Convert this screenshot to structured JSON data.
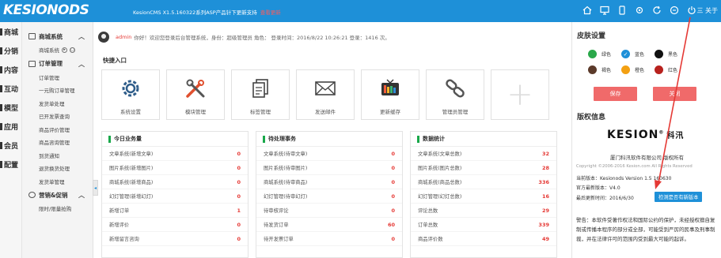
{
  "header": {
    "logo": "KESIONODS",
    "version_text": "KesionCMS X1.5.160322系列ASP产品针下更新支持",
    "version_link": "查看更新",
    "menu_label": "三 关于"
  },
  "leftnav": [
    "商城",
    "分销",
    "内容",
    "互动",
    "模型",
    "应用",
    "会员",
    "配置"
  ],
  "sidebar": {
    "group1": "商城系统",
    "group1_sub": "商城系统",
    "group2": "订单管理",
    "orders": [
      "订单管理",
      "一元购订单管理",
      "发货单处理",
      "已开发票查询",
      "商品评价管理",
      "商品咨询管理",
      "到货通知",
      "退货换货处理",
      "发货单管理"
    ],
    "group3": "营销&促销",
    "promo": [
      "限时/限量抢购"
    ]
  },
  "welcome": {
    "user": "admin",
    "text": "你好！欢迎您登录后台管理系统，身份：超级管理员 角色：    登录时间：2016/8/22 10:26:21  登录：1416 次。"
  },
  "quick": {
    "title": "快捷入口",
    "items": [
      "系统设置",
      "模块管理",
      "标签管理",
      "发送邮件",
      "更新缓存",
      "管理员管理"
    ]
  },
  "panels": [
    {
      "title": "今日业务量",
      "rows": [
        {
          "label": "文章系统(新增文章)",
          "value": "0"
        },
        {
          "label": "图片系统(新增图片)",
          "value": "0"
        },
        {
          "label": "商城系统(新增商品)",
          "value": "0"
        },
        {
          "label": "幻灯管理(新增幻灯)",
          "value": "0"
        },
        {
          "label": "新增订单",
          "value": "1"
        },
        {
          "label": "新增评价",
          "value": "0"
        },
        {
          "label": "新增留言咨询",
          "value": "0"
        }
      ]
    },
    {
      "title": "待处理事务",
      "rows": [
        {
          "label": "文章系统(待审文章)",
          "value": "0"
        },
        {
          "label": "图片系统(待审图片)",
          "value": "0"
        },
        {
          "label": "商城系统(待审商品)",
          "value": "0"
        },
        {
          "label": "幻灯管理(待审幻灯)",
          "value": "0"
        },
        {
          "label": "待审核评论",
          "value": "0"
        },
        {
          "label": "待发货订单",
          "value": "60"
        },
        {
          "label": "待开发票订单",
          "value": "0"
        }
      ]
    },
    {
      "title": "数据统计",
      "rows": [
        {
          "label": "文章系统(文章总数)",
          "value": "32"
        },
        {
          "label": "图片系统(图片总数)",
          "value": "28"
        },
        {
          "label": "商城系统(商品总数)",
          "value": "336"
        },
        {
          "label": "幻灯管理(幻灯总数)",
          "value": "16"
        },
        {
          "label": "评论总数",
          "value": "29"
        },
        {
          "label": "订单总数",
          "value": "339"
        },
        {
          "label": "商品评价数",
          "value": "49"
        }
      ]
    }
  ],
  "right": {
    "skin_title": "皮肤设置",
    "skins": [
      {
        "label": "绿色",
        "color": "#2aa84a",
        "checked": false
      },
      {
        "label": "蓝色",
        "color": "#1e90d8",
        "checked": true
      },
      {
        "label": "黑色",
        "color": "#111111",
        "checked": false
      },
      {
        "label": "褐色",
        "color": "#5b3a2a",
        "checked": false
      },
      {
        "label": "橙色",
        "color": "#f3a012",
        "checked": false
      },
      {
        "label": "红色",
        "color": "#e53935",
        "checked": false
      }
    ],
    "save_label": "保存",
    "close_label": "关闭",
    "copyright_title": "版权信息",
    "brand": "KESION",
    "brand_cn": "科汛",
    "company": "厦门科汛软件有限公司  版权所有",
    "copyright": "Copyright ©2006-2016 Kesion.com All Rights Reserved",
    "current_version": "当前版本：Kesionods Version 1.5 160630",
    "official_version": "官方最新版本：V4.0",
    "update_time": "最后更新时间：2016/6/30",
    "update_btn": "检测是否有新版本",
    "note": "警告：本软件受著作权法和国际公约的保护，未经授权擅自复制或传播本程序的部分或全部，可能受到严厉的民事及刑事制裁，并在法律许可的范围内受到最大可能的起诉。"
  }
}
